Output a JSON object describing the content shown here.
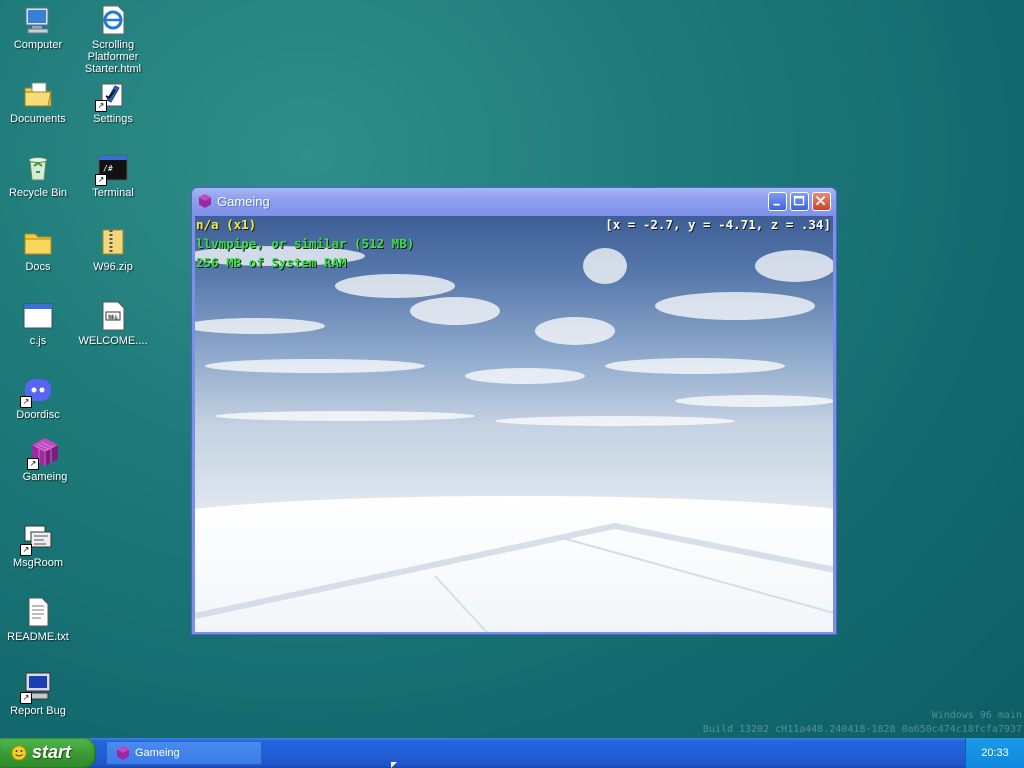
{
  "desktop": {
    "icons": [
      {
        "label": "Computer",
        "icon": "computer-icon"
      },
      {
        "label": "Scrolling Platformer Starter.html",
        "icon": "internet-explorer-icon"
      },
      {
        "label": "Documents",
        "icon": "documents-folder-icon"
      },
      {
        "label": "Settings",
        "icon": "settings-icon"
      },
      {
        "label": "Recycle Bin",
        "icon": "recycle-bin-icon"
      },
      {
        "label": "Terminal",
        "icon": "terminal-icon"
      },
      {
        "label": "Docs",
        "icon": "folder-icon"
      },
      {
        "label": "W96.zip",
        "icon": "zip-folder-icon"
      },
      {
        "label": "c.js",
        "icon": "window-app-icon"
      },
      {
        "label": "WELCOME....",
        "icon": "markdown-file-icon"
      },
      {
        "label": "Doordisc",
        "icon": "discord-icon"
      },
      {
        "label": "Gameing",
        "icon": "purple-cube-icon"
      },
      {
        "label": "MsgRoom",
        "icon": "msgroom-icon"
      },
      {
        "label": "README.txt",
        "icon": "text-file-icon"
      },
      {
        "label": "Report Bug",
        "icon": "report-bug-icon"
      }
    ]
  },
  "window": {
    "title": "Gameing",
    "hud": {
      "fps": "n/a (x1)",
      "gpu": "llvmpipe, or similar (512 MB)",
      "ram": "256 MB of System RAM",
      "coords": "[x = -2.7, y = -4.71, z = .34]"
    }
  },
  "watermark": {
    "line1": "Windows 96 main",
    "line2": "Build 13202 cH11a448.240418-1828 0a650c474c18fcfa7937"
  },
  "taskbar": {
    "start_label": "start",
    "task_label": "Gameing",
    "clock": "20:33"
  }
}
